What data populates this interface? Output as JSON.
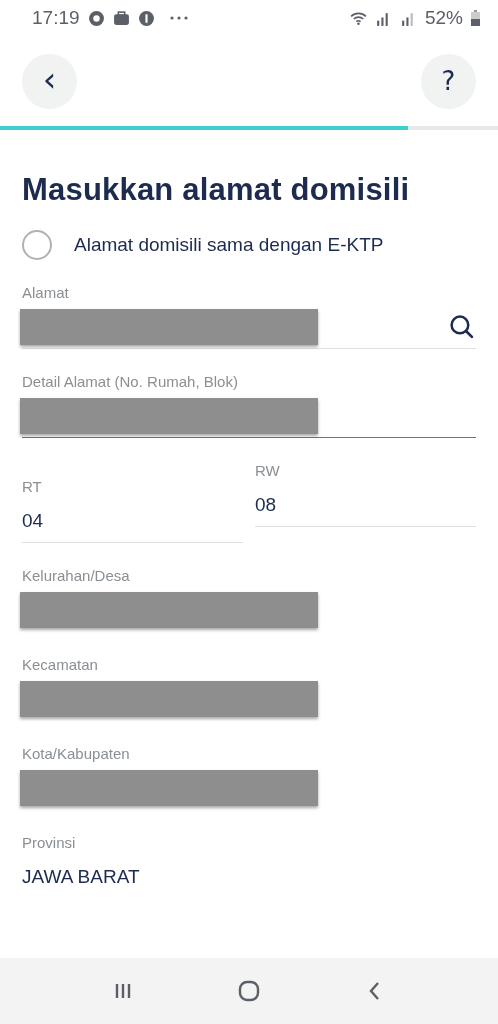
{
  "status_bar": {
    "time": "17:19",
    "battery": "52%"
  },
  "header": {
    "back": "‹",
    "help": "?"
  },
  "progress": {
    "level": 0.82
  },
  "title": "Masukkan alamat domisili",
  "same_as_ektp": {
    "label": "Alamat domisili sama dengan E-KTP",
    "checked": false
  },
  "fields": [
    {
      "kind": "search",
      "label": "Alamat",
      "redacted": true,
      "underline": true,
      "active": false
    },
    {
      "kind": "text",
      "label": "Detail Alamat (No. Rumah, Blok)",
      "redacted": true,
      "underline": true,
      "active": true
    },
    {
      "kind": "pair",
      "items": [
        {
          "label": "RT",
          "value": "04"
        },
        {
          "label": "RW",
          "value": "08"
        }
      ]
    },
    {
      "kind": "text",
      "label": "Kelurahan/Desa",
      "redacted": true,
      "underline": false,
      "active": false
    },
    {
      "kind": "text",
      "label": "Kecamatan",
      "redacted": true,
      "underline": false,
      "active": false
    },
    {
      "kind": "text",
      "label": "Kota/Kabupaten",
      "redacted": true,
      "underline": false,
      "active": false
    },
    {
      "kind": "text",
      "label": "Provinsi",
      "value": "JAWA BARAT",
      "underline": false,
      "active": false
    }
  ]
}
